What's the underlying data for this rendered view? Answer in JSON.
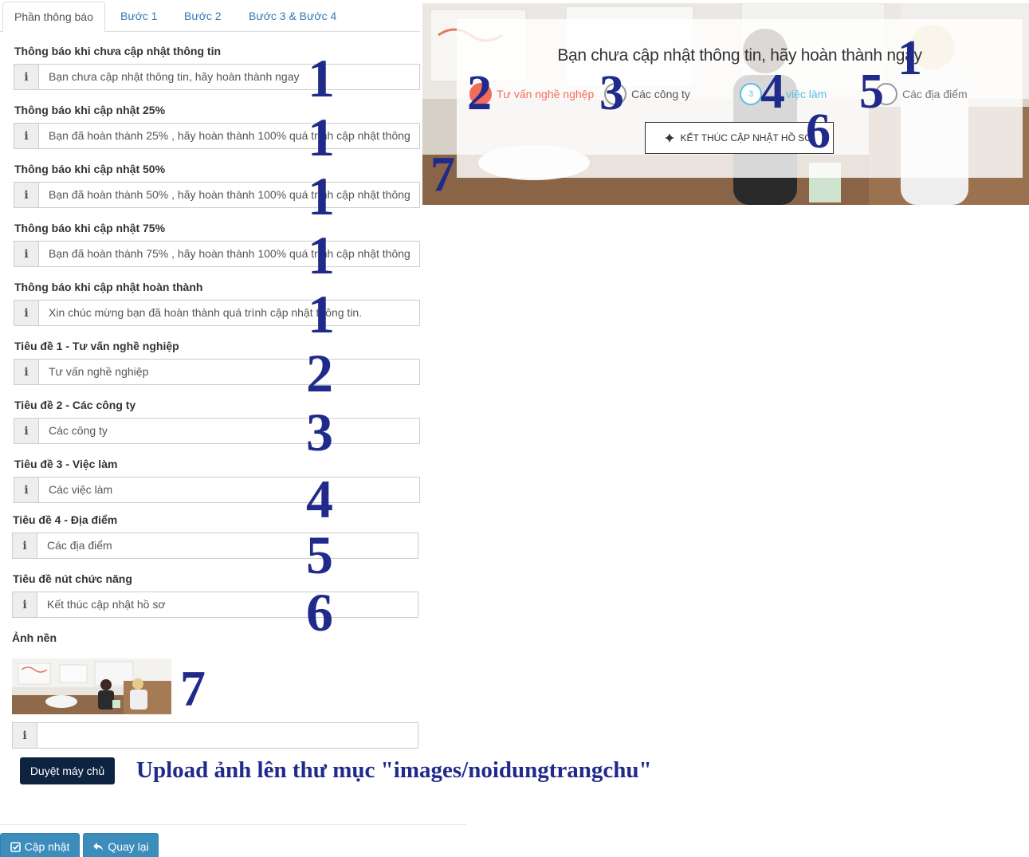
{
  "tabs": [
    {
      "label": "Phần thông báo",
      "active": true
    },
    {
      "label": "Bước 1"
    },
    {
      "label": "Bước 2"
    },
    {
      "label": "Bước 3 & Bước 4"
    }
  ],
  "fields": [
    {
      "label": "Thông báo khi chưa cập nhật thông tin",
      "value": "Bạn chưa cập nhật thông tin, hãy hoàn thành ngay",
      "marker": "1"
    },
    {
      "label": "Thông báo khi cập nhật 25%",
      "value": "Bạn đã hoàn thành 25% , hãy hoàn thành 100% quá trình cập nhật thông",
      "marker": "1"
    },
    {
      "label": "Thông báo khi cập nhật 50%",
      "value": "Bạn đã hoàn thành 50% , hãy hoàn thành 100% quá trình cập nhật thông",
      "marker": "1"
    },
    {
      "label": "Thông báo khi cập nhật 75%",
      "value": "Bạn đã hoàn thành 75% , hãy hoàn thành 100% quá trình cập nhật thông",
      "marker": "1"
    },
    {
      "label": "Thông báo khi cập nhật hoàn thành",
      "value": "Xin chúc mừng bạn đã hoàn thành quá trình cập nhật thông tin.",
      "marker": "1"
    },
    {
      "label": "Tiêu đề 1 - Tư vấn nghề nghiệp",
      "value": "Tư vấn nghề nghiệp",
      "marker": "2"
    },
    {
      "label": "Tiêu đề 2 - Các công ty",
      "value": "Các công ty",
      "marker": "3"
    },
    {
      "label": "Tiêu đề 3 - Việc làm",
      "value": "Các việc làm",
      "marker": "4"
    },
    {
      "label": "Tiêu đề 4 - Địa điểm",
      "value": "Các địa điểm",
      "marker": "5"
    },
    {
      "label": "Tiêu đề nút chức năng",
      "value": "Kết thúc cập nhật hồ sơ",
      "marker": "6"
    }
  ],
  "info_icon": "i",
  "background": {
    "label": "Ảnh nền",
    "marker": "7",
    "file_value": "",
    "browse_label": "Duyệt máy chủ",
    "upload_note": "Upload ảnh lên thư mục \"images/noidungtrangchu\""
  },
  "actions": {
    "update_label": "Cập nhật",
    "back_label": "Quay lại"
  },
  "preview": {
    "title": "Bạn chưa cập nhật thông tin, hãy hoàn thành ngay",
    "steps": [
      {
        "label": "Tư vấn nghề nghệp",
        "number": "",
        "color": "#f26b5b"
      },
      {
        "label": "Các công ty",
        "number": "",
        "color": "#555555"
      },
      {
        "label": "việc làm",
        "number": "3",
        "color": "#5bc0de"
      },
      {
        "label": "Các địa điểm",
        "number": "",
        "color": "#777777"
      }
    ],
    "finish_button": "KẾT THÚC CẬP NHẬT HỒ SƠ",
    "markers": [
      "1",
      "2",
      "3",
      "4",
      "5",
      "6",
      "7"
    ]
  },
  "colors": {
    "annotation": "#1f2a8a",
    "tab_link": "#337ab7",
    "primary_button": "#3c8dbc",
    "dark_button": "#0d2340",
    "step_active": "#f26b5b",
    "step_current": "#5bc0de"
  },
  "icons": {
    "update": "check-square-icon",
    "back": "reply-arrow-icon",
    "finish": "gear-icon"
  }
}
